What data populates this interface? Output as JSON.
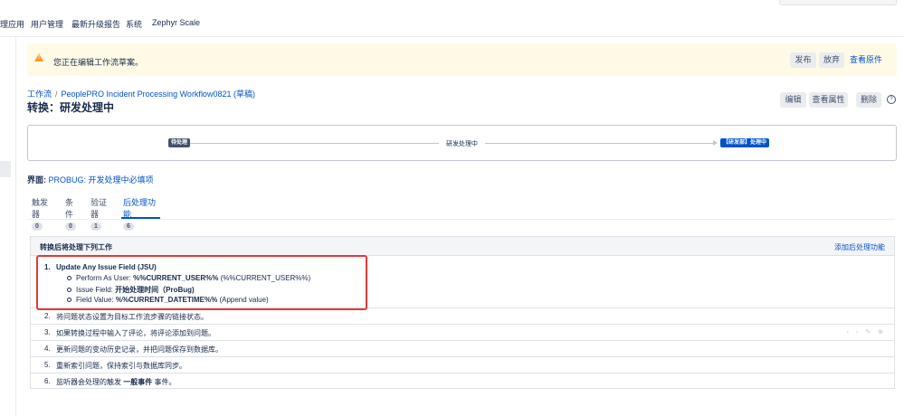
{
  "topnav": {
    "items": [
      "理应用",
      "用户管理",
      "最新升级报告",
      "系统",
      "Zephyr Scale"
    ]
  },
  "banner": {
    "message": "您正在编辑工作流草案。",
    "publish": "发布",
    "discard": "放弃",
    "view_original": "查看原件"
  },
  "breadcrumb": {
    "root": "工作流",
    "separator": "/",
    "workflow": "PeoplePRO Incident Processing Workflow0821 (草稿)"
  },
  "page_title": "转换：研发处理中",
  "actions": {
    "edit": "编辑",
    "view_properties": "查看属性",
    "delete": "删除",
    "help": "?"
  },
  "diagram": {
    "from_status": "待处理",
    "transition": "研发处理中",
    "to_status": "【研发部】处理中"
  },
  "screen": {
    "label": "界面:",
    "value": "PROBUG: 开发处理中必填项"
  },
  "tabs": [
    {
      "label": "触发器",
      "count": "0"
    },
    {
      "label": "条件",
      "count": "0"
    },
    {
      "label": "验证器",
      "count": "1"
    },
    {
      "label": "后处理功能",
      "count": "6"
    }
  ],
  "postfunctions": {
    "header": "转换后将处理下列工作",
    "add_label": "添加后处理功能",
    "items": [
      {
        "num": "1.",
        "title": "Update Any Issue Field (JSU)",
        "details": [
          {
            "label": "Perform As User:",
            "value": "%%CURRENT_USER%%",
            "extra": "(%%CURRENT_USER%%)"
          },
          {
            "label": "Issue Field:",
            "value": "开始处理时间（ProBug)",
            "extra": ""
          },
          {
            "label": "Field Value:",
            "value": "%%CURRENT_DATETIME%%",
            "extra": "(Append value)"
          }
        ]
      },
      {
        "num": "2.",
        "text": "将问题状态设置为目标工作流步骤的链接状态。"
      },
      {
        "num": "3.",
        "text": "如果转换过程中输入了评论，将评论添加到问题。"
      },
      {
        "num": "4.",
        "text": "更新问题的变动历史记录，并把问题保存到数据库。"
      },
      {
        "num": "5.",
        "text": "重新索引问题，保持索引与数据库同步。"
      },
      {
        "num": "6.",
        "text_before": "监听器会处理的触发",
        "text_bold": "一般事件",
        "text_after": "事件。"
      }
    ]
  },
  "colors": {
    "accent": "#0052cc",
    "banner_bg": "#fffae6",
    "warning": "#ff991f",
    "highlight_border": "#e53935"
  }
}
